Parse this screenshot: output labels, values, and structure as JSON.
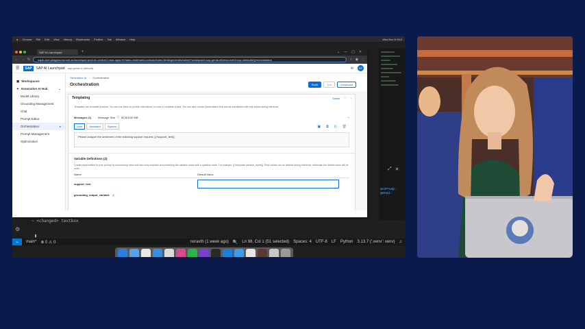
{
  "mac_menubar": {
    "items": [
      "Chrome",
      "File",
      "Edit",
      "View",
      "History",
      "Bookmarks",
      "Profiles",
      "Tab",
      "Window",
      "Help"
    ],
    "clock": "Wed Nov 6 09:2"
  },
  "browser": {
    "tab_title": "SAP AI Launchpad",
    "url": "sapit-core-playground-vole.ai-launchpad.prod.eu-central-1.aws.apps.ml.hana.ondemand.com/aic/index.html#/generativeaihub?workspace=sap-genai-xl&resourceGroup=default&/g/orchestration"
  },
  "sap": {
    "logo": "SAP",
    "title": "SAP AI Launchpad",
    "subtitle": "sap-genai-xl (default)",
    "avatar": "NT",
    "sidebar": [
      {
        "label": "Workspaces",
        "bold": true
      },
      {
        "label": "Generative AI Hub",
        "bold": true,
        "expandable": true
      },
      {
        "label": "Model Library",
        "sub": true
      },
      {
        "label": "Grounding Management",
        "sub": true
      },
      {
        "label": "Chat",
        "sub": true
      },
      {
        "label": "Prompt Editor",
        "sub": true
      },
      {
        "label": "Orchestration",
        "sub": true,
        "active": true
      },
      {
        "label": "Prompt Management",
        "sub": true
      },
      {
        "label": "Optimization",
        "sub": true
      }
    ],
    "breadcrumb": [
      "Generative AI",
      "Orchestration"
    ],
    "page_title": "Orchestration",
    "buttons": {
      "build": "Build",
      "test": "Test",
      "download": "Download"
    },
    "templating": {
      "title": "Templating",
      "select": "Select",
      "description": "Templates are reusable prompts. You can use them to provide instructions on how to complete a task. You can also include placeholders that can be substituted with real values during inference.",
      "messages_label": "Messages (1)",
      "message_size_label": "Message Size",
      "message_size_value": "80 B/5.00 MB",
      "roles": [
        "User",
        "Assistant",
        "System"
      ],
      "message_text": "Please analyze the sentiment of the following support request: {{?support_text}}"
    },
    "variables": {
      "title": "Variable Definitions (2)",
      "description": "Create placeholders in your prompt by surrounding them with two curly brackets and preceding the variable name with a question mark. For example, {{?template variable_name}}. Real values can be defined during inference, otherwise the default value will be used.",
      "col_name": "Name",
      "col_default": "Default Value",
      "rows": [
        {
          "name": "support_text"
        },
        {
          "name": "grounding_output_variable"
        }
      ]
    }
  },
  "vscode": {
    "terminal_line": "~ <changed> textbox",
    "side_link": "ace=sap-genai-",
    "status": {
      "branch": "main*",
      "problems": "⊗ 0 ⚠ 0",
      "blame": "noravth (1 week ago)",
      "position": "Ln 98, Col 1 (51 selected)",
      "spaces": "Spaces: 4",
      "encoding": "UTF-8",
      "eol": "LF",
      "language": "Python",
      "interpreter": "3.13.7 ('.venv': venv)"
    }
  },
  "colors": {
    "background": "#0a1a4a",
    "sap_blue": "#0a6ed1",
    "vscode_blue": "#0078d4"
  }
}
